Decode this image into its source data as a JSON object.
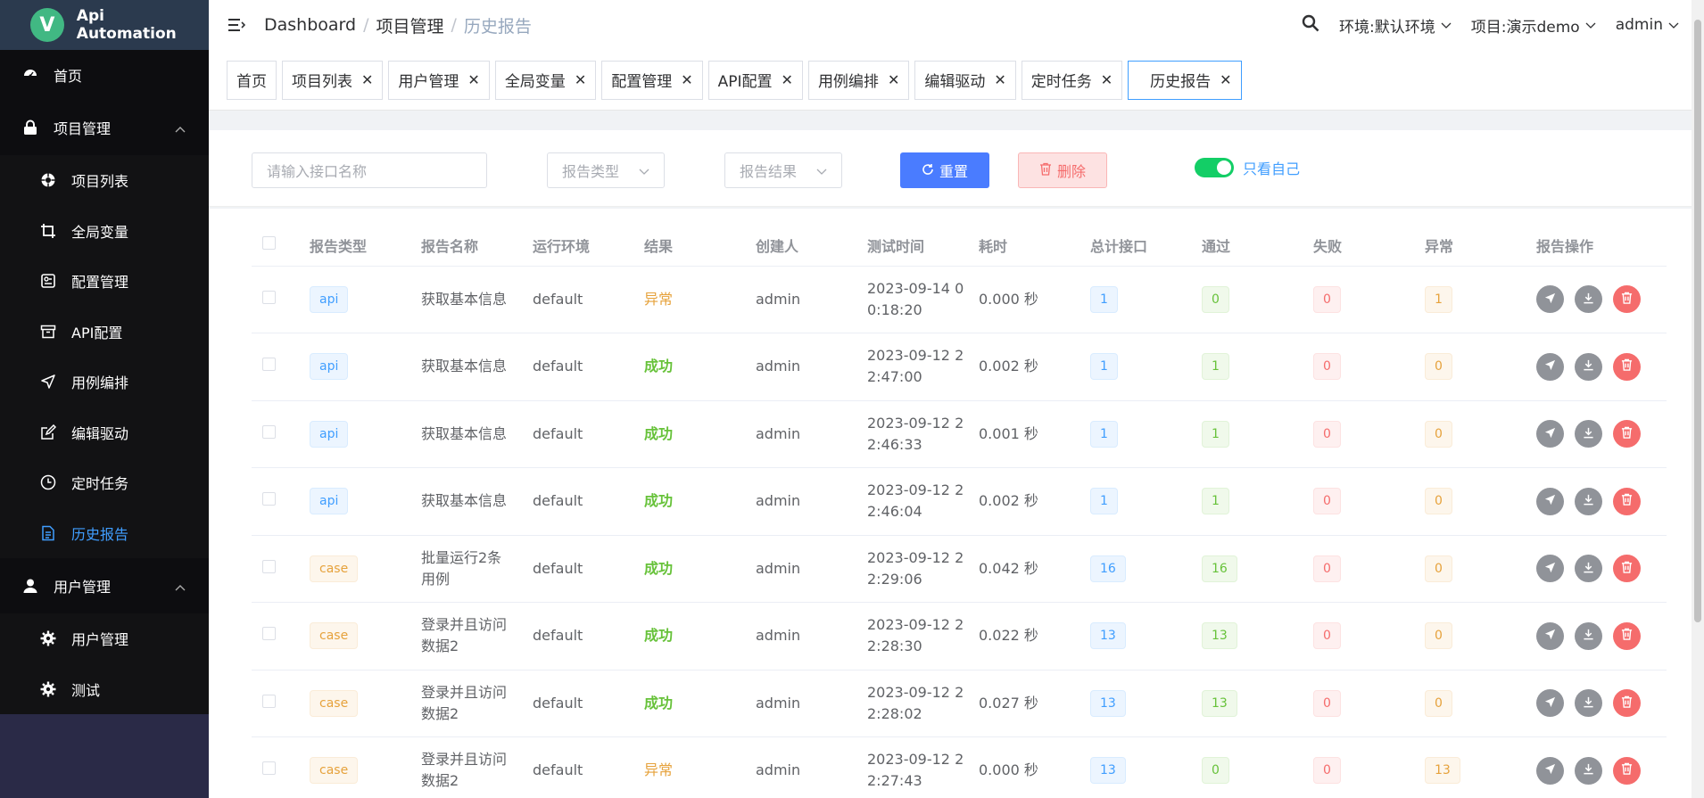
{
  "app": {
    "logo_letter": "V",
    "title": "Api Automation"
  },
  "sidebar": {
    "home": "首页",
    "group_project": "项目管理",
    "project_items": [
      {
        "label": "项目列表",
        "icon": "project-list-icon"
      },
      {
        "label": "全局变量",
        "icon": "crop-icon"
      },
      {
        "label": "配置管理",
        "icon": "config-icon"
      },
      {
        "label": "API配置",
        "icon": "archive-icon"
      },
      {
        "label": "用例编排",
        "icon": "send-icon"
      },
      {
        "label": "编辑驱动",
        "icon": "edit-icon"
      },
      {
        "label": "定时任务",
        "icon": "clock-icon"
      },
      {
        "label": "历史报告",
        "icon": "document-icon"
      }
    ],
    "group_user": "用户管理",
    "user_items": [
      {
        "label": "用户管理",
        "icon": "gear-icon"
      },
      {
        "label": "测试",
        "icon": "gear-icon"
      }
    ]
  },
  "topbar": {
    "breadcrumb": [
      "Dashboard",
      "项目管理",
      "历史报告"
    ],
    "env": "环境:默认环境",
    "project": "项目:演示demo",
    "user": "admin"
  },
  "tags": [
    "首页",
    "项目列表",
    "用户管理",
    "全局变量",
    "配置管理",
    "API配置",
    "用例编排",
    "编辑驱动",
    "定时任务",
    "历史报告"
  ],
  "filter": {
    "name_placeholder": "请输入接口名称",
    "type_placeholder": "报告类型",
    "result_placeholder": "报告结果",
    "reset_label": "重置",
    "delete_label": "删除",
    "only_mine_label": "只看自己"
  },
  "table": {
    "headers": [
      "报告类型",
      "报告名称",
      "运行环境",
      "结果",
      "创建人",
      "测试时间",
      "耗时",
      "总计接口",
      "通过",
      "失败",
      "异常",
      "报告操作"
    ],
    "rows": [
      {
        "type": "api",
        "name": "获取基本信息",
        "env": "default",
        "result": "异常",
        "creator": "admin",
        "time": "2023-09-14 0 0:18:20",
        "duration": "0.000 秒",
        "total": "1",
        "pass": "0",
        "fail": "0",
        "error": "1"
      },
      {
        "type": "api",
        "name": "获取基本信息",
        "env": "default",
        "result": "成功",
        "creator": "admin",
        "time": "2023-09-12 2 2:47:00",
        "duration": "0.002 秒",
        "total": "1",
        "pass": "1",
        "fail": "0",
        "error": "0"
      },
      {
        "type": "api",
        "name": "获取基本信息",
        "env": "default",
        "result": "成功",
        "creator": "admin",
        "time": "2023-09-12 2 2:46:33",
        "duration": "0.001 秒",
        "total": "1",
        "pass": "1",
        "fail": "0",
        "error": "0"
      },
      {
        "type": "api",
        "name": "获取基本信息",
        "env": "default",
        "result": "成功",
        "creator": "admin",
        "time": "2023-09-12 2 2:46:04",
        "duration": "0.002 秒",
        "total": "1",
        "pass": "1",
        "fail": "0",
        "error": "0"
      },
      {
        "type": "case",
        "name": "批量运行2条 用例",
        "env": "default",
        "result": "成功",
        "creator": "admin",
        "time": "2023-09-12 2 2:29:06",
        "duration": "0.042 秒",
        "total": "16",
        "pass": "16",
        "fail": "0",
        "error": "0"
      },
      {
        "type": "case",
        "name": "登录并且访问 数据2",
        "env": "default",
        "result": "成功",
        "creator": "admin",
        "time": "2023-09-12 2 2:28:30",
        "duration": "0.022 秒",
        "total": "13",
        "pass": "13",
        "fail": "0",
        "error": "0"
      },
      {
        "type": "case",
        "name": "登录并且访问 数据2",
        "env": "default",
        "result": "成功",
        "creator": "admin",
        "time": "2023-09-12 2 2:28:02",
        "duration": "0.027 秒",
        "total": "13",
        "pass": "13",
        "fail": "0",
        "error": "0"
      },
      {
        "type": "case",
        "name": "登录并且访问 数据2",
        "env": "default",
        "result": "异常",
        "creator": "admin",
        "time": "2023-09-12 2 2:27:43",
        "duration": "0.000 秒",
        "total": "13",
        "pass": "0",
        "fail": "0",
        "error": "13"
      }
    ]
  },
  "colors": {
    "accent": "#409eff",
    "success": "#67c23a",
    "warning": "#e6a23c",
    "danger": "#f56c6c",
    "reset_button": "#4a7cff",
    "switch_on": "#13ce66"
  }
}
